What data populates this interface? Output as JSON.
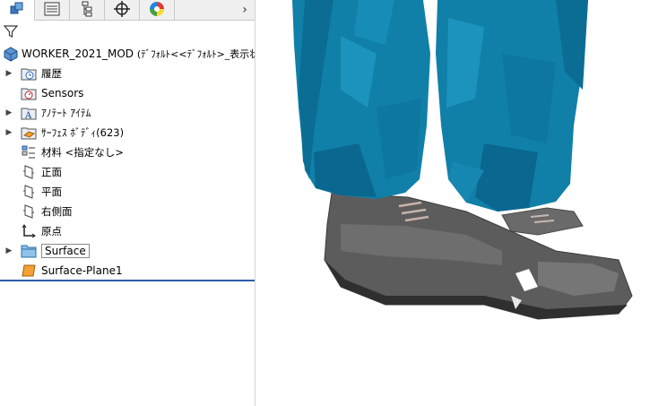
{
  "tabs": [
    {
      "name": "feature-manager",
      "icon": "feature-tree-icon"
    },
    {
      "name": "property-manager",
      "icon": "property-list-icon"
    },
    {
      "name": "configuration-manager",
      "icon": "configuration-icon"
    },
    {
      "name": "dimxpert-manager",
      "icon": "crosshair-icon"
    },
    {
      "name": "display-manager",
      "icon": "color-wheel-icon"
    }
  ],
  "tabs_more": "›",
  "tree": {
    "root": {
      "label": "WORKER_2021_MOD",
      "suffix": "(ﾃﾞﾌｫﾙﾄ<<ﾃﾞﾌｫﾙﾄ>_表示状"
    },
    "items": [
      {
        "label": "履歴",
        "icon": "history-folder-icon",
        "expandable": true
      },
      {
        "label": "Sensors",
        "icon": "sensor-icon",
        "expandable": false
      },
      {
        "label": "ｱﾉﾃｰﾄ ｱｲﾃﾑ",
        "icon": "annotation-icon",
        "expandable": true
      },
      {
        "label": "ｻｰﾌｪｽ ﾎﾞﾃﾞｨ(623)",
        "icon": "surface-bodies-icon",
        "expandable": true
      },
      {
        "label": "材料 <指定なし>",
        "icon": "material-icon",
        "expandable": false
      },
      {
        "label": "正面",
        "icon": "plane-icon",
        "expandable": false
      },
      {
        "label": "平面",
        "icon": "plane-icon",
        "expandable": false
      },
      {
        "label": "右側面",
        "icon": "plane-icon",
        "expandable": false
      },
      {
        "label": "原点",
        "icon": "origin-icon",
        "expandable": false
      },
      {
        "label": "Surface",
        "icon": "folder-icon",
        "expandable": true,
        "selected": true
      },
      {
        "label": "Surface-Plane1",
        "icon": "surface-plane-icon",
        "expandable": false
      }
    ]
  },
  "colors": {
    "pants": "#1080a8",
    "shoes": "#5a5a5a",
    "rollback": "#2a5caa"
  }
}
